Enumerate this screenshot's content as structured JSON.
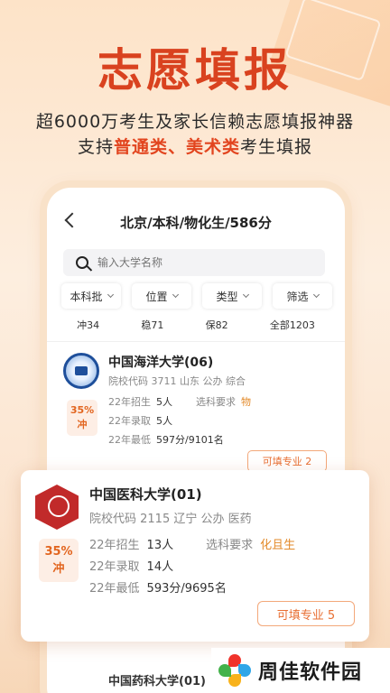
{
  "hero": {
    "title": "志愿填报",
    "subtitle1": "超6000万考生及家长信赖志愿填报神器",
    "subtitle2_pre": "支持",
    "subtitle2_hl1": "普通类",
    "subtitle2_sep": "、",
    "subtitle2_hl2": "美术类",
    "subtitle2_post": "考生填报"
  },
  "nav": {
    "title": "北京/本科/物化生/586分"
  },
  "search": {
    "placeholder": "输入大学名称"
  },
  "filters": [
    "本科批",
    "位置",
    "类型",
    "筛选"
  ],
  "tabs": [
    "冲34",
    "稳71",
    "保82",
    "全部1203"
  ],
  "card1": {
    "name": "中国海洋大学(06)",
    "meta": "院校代码 3711 山东 公办 综合",
    "badge_pct": "35%",
    "badge_tag": "冲",
    "rows": [
      {
        "label": "22年招生",
        "value": "5人",
        "req_label": "选科要求",
        "req_value": "物"
      },
      {
        "label": "22年录取",
        "value": "5人"
      },
      {
        "label": "22年最低",
        "value": "597分/9101名"
      }
    ],
    "button": "可填专业 2"
  },
  "card2": {
    "name": "中国医科大学(01)",
    "meta": "院校代码 2115 辽宁 公办 医药",
    "badge_pct": "35%",
    "badge_tag": "冲",
    "rows": [
      {
        "label": "22年招生",
        "value": "13人",
        "req_label": "选科要求",
        "req_value": "化且生"
      },
      {
        "label": "22年录取",
        "value": "14人"
      },
      {
        "label": "22年最低",
        "value": "593分/9695名"
      }
    ],
    "button": "可填专业 5"
  },
  "card3": {
    "name_partial": "中国药科大学(01)"
  },
  "watermark": {
    "text": "周佳软件园"
  },
  "colors": {
    "accent": "#d9421f",
    "orange": "#e86f33"
  }
}
